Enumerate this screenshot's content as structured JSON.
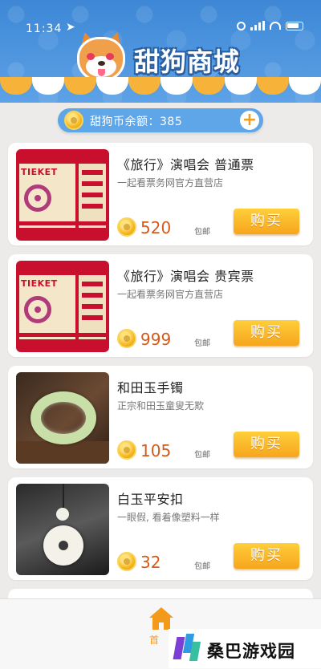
{
  "status_bar": {
    "time": "11:34"
  },
  "header": {
    "brand_title": "甜狗商城"
  },
  "balance": {
    "text": "甜狗币余额：385",
    "add_label": "+"
  },
  "products": [
    {
      "title": "《旅行》演唱会  普通票",
      "subtitle": "一起看票务网官方直营店",
      "price": "520",
      "shipping": "包邮",
      "buy_label": "购买",
      "ticket_text": "TIEKET"
    },
    {
      "title": "《旅行》演唱会  贵宾票",
      "subtitle": "一起看票务网官方直营店",
      "price": "999",
      "shipping": "包邮",
      "buy_label": "购买",
      "ticket_text": "TIEKET"
    },
    {
      "title": "和田玉手镯",
      "subtitle": "正宗和田玉童叟无欺",
      "price": "105",
      "shipping": "包邮",
      "buy_label": "购买"
    },
    {
      "title": "白玉平安扣",
      "subtitle": "一眼假, 看着像塑料一样",
      "price": "32",
      "shipping": "包邮",
      "buy_label": "购买"
    }
  ],
  "bottom_nav": {
    "home_label": "首"
  },
  "watermark": {
    "text": "桑巴游戏园"
  },
  "colors": {
    "header_blue": "#4a90d9",
    "accent_orange": "#f39a1b",
    "price_orange": "#d65a18"
  }
}
